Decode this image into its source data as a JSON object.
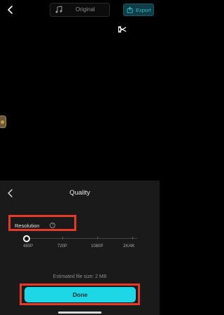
{
  "header": {
    "aspect_label": "Original",
    "export_label": "Export"
  },
  "panel": {
    "title": "Quality",
    "resolution_label": "Resolution",
    "resolution_options": [
      "480P",
      "720P",
      "1080P",
      "2K/4K"
    ],
    "selected_resolution": "480P",
    "file_size_text": "Estimated file size: 2 MB",
    "done_label": "Done"
  },
  "colors": {
    "accent": "#1dd7e6",
    "highlight": "#e53a2a",
    "panel_bg": "#1a1a1a"
  },
  "icons": [
    "back-icon",
    "music-note-icon",
    "export-icon",
    "capcut-logo-icon",
    "info-icon"
  ]
}
